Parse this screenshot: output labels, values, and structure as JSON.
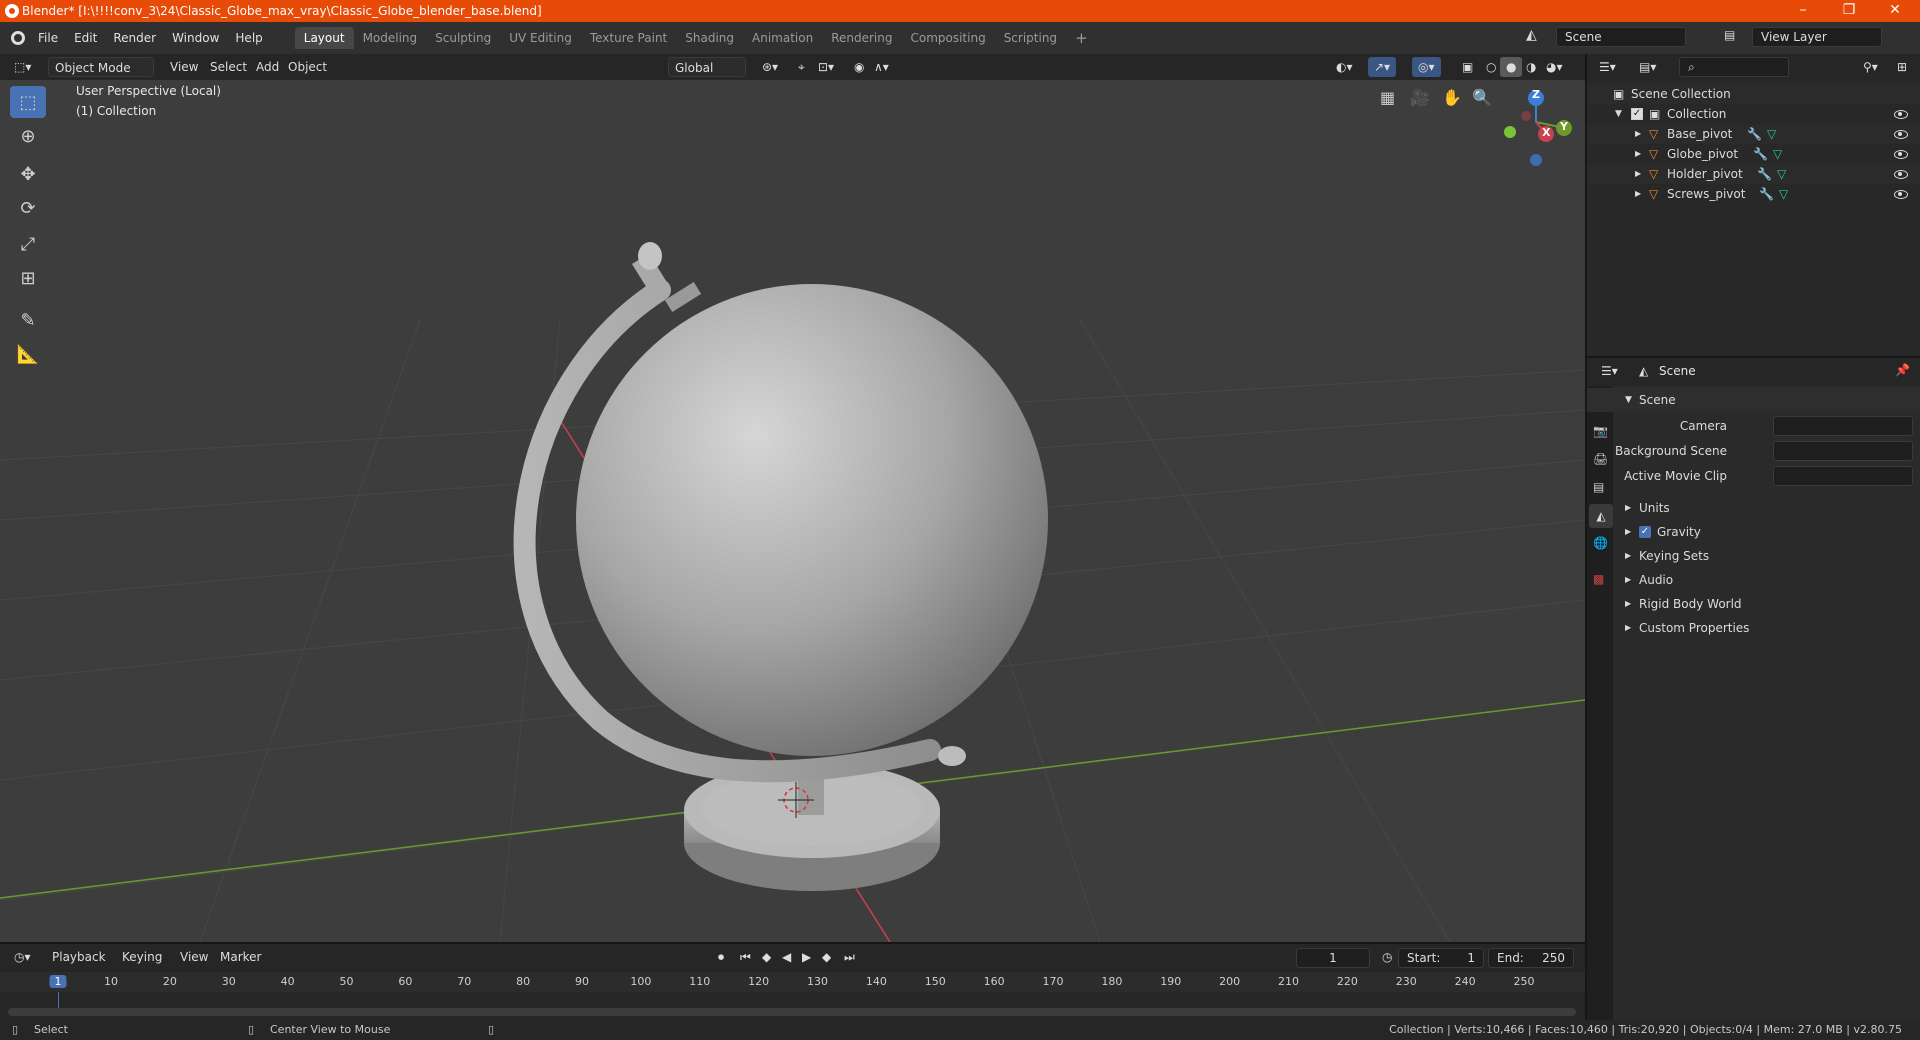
{
  "window": {
    "title": "Blender* [I:\\!!!!conv_3\\24\\Classic_Globe_max_vray\\Classic_Globe_blender_base.blend]",
    "minimize": "–",
    "maximize": "❐",
    "close": "✕"
  },
  "menubar": {
    "items": [
      "File",
      "Edit",
      "Render",
      "Window",
      "Help"
    ],
    "workspaces": [
      "Layout",
      "Modeling",
      "Sculpting",
      "UV Editing",
      "Texture Paint",
      "Shading",
      "Animation",
      "Rendering",
      "Compositing",
      "Scripting"
    ],
    "add_workspace": "+",
    "scene_name": "Scene",
    "view_layer": "View Layer"
  },
  "viewport_header": {
    "mode": "Object Mode",
    "menus": [
      "View",
      "Select",
      "Add",
      "Object"
    ],
    "orientation": "Global"
  },
  "viewport": {
    "perspective_label": "User Perspective (Local)",
    "collection_label": "(1) Collection",
    "gizmo": {
      "z": "Z",
      "y": "Y",
      "x": "X"
    }
  },
  "outliner": {
    "root": "Scene Collection",
    "collection": "Collection",
    "objects": [
      "Base_pivot",
      "Globe_pivot",
      "Holder_pivot",
      "Screws_pivot"
    ]
  },
  "properties": {
    "context": "Scene",
    "section": "Scene",
    "fields": [
      {
        "label": "Camera",
        "value": ""
      },
      {
        "label": "Background Scene",
        "value": ""
      },
      {
        "label": "Active Movie Clip",
        "value": ""
      }
    ],
    "panels": [
      "Units",
      "Gravity",
      "Keying Sets",
      "Audio",
      "Rigid Body World",
      "Custom Properties"
    ],
    "gravity_checked": true
  },
  "timeline": {
    "menus": [
      "Playback",
      "Keying",
      "View",
      "Marker"
    ],
    "current_frame": "1",
    "start_label": "Start:",
    "start": "1",
    "end_label": "End:",
    "end": "250",
    "ticks": [
      "1",
      "10",
      "20",
      "30",
      "40",
      "50",
      "60",
      "70",
      "80",
      "90",
      "100",
      "110",
      "120",
      "130",
      "140",
      "150",
      "160",
      "170",
      "180",
      "190",
      "200",
      "210",
      "220",
      "230",
      "240",
      "250"
    ]
  },
  "statusbar": {
    "left": "Select",
    "middle": "Center View to Mouse",
    "right": "Collection | Verts:10,466 | Faces:10,460 | Tris:20,920 | Objects:0/4 | Mem: 27.0 MB | v2.80.75"
  },
  "colors": {
    "accent": "#4772b3",
    "titlebar": "#e84a08",
    "viewport_bg": "#3d3d3d",
    "x_axis": "#c8414f",
    "y_axis": "#6c9a2a",
    "z_axis": "#3d7fd6"
  }
}
